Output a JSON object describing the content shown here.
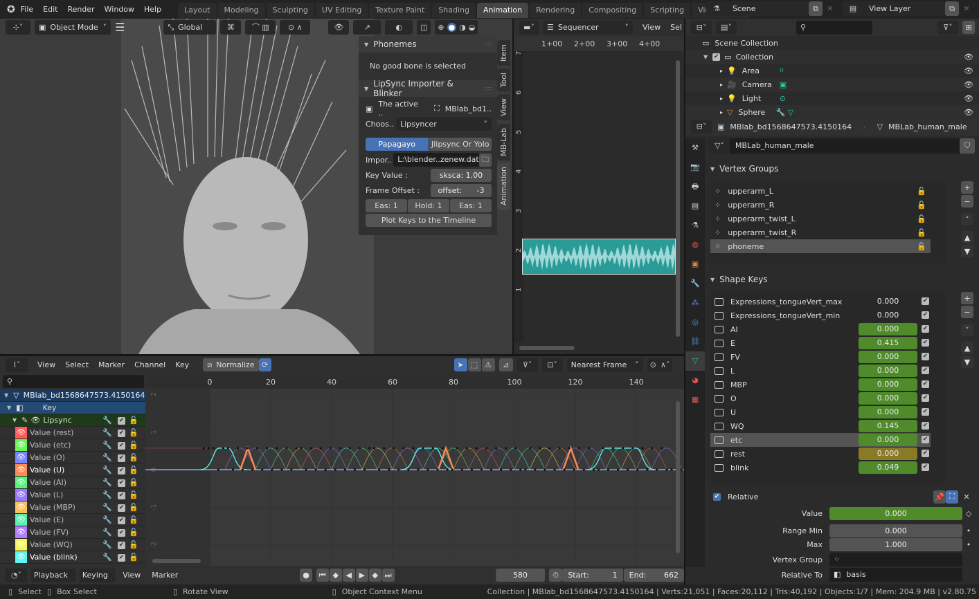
{
  "topbar": {
    "menus": [
      "File",
      "Edit",
      "Render",
      "Window",
      "Help"
    ],
    "workspaces": [
      "Layout",
      "Modeling",
      "Sculpting",
      "UV Editing",
      "Texture Paint",
      "Shading",
      "Animation",
      "Rendering",
      "Compositing",
      "Scripting",
      "Video Editin"
    ],
    "active_workspace": "Animation",
    "scene": "Scene",
    "view_layer": "View Layer"
  },
  "viewport": {
    "mode": "Object Mode",
    "orientation": "Global"
  },
  "npanel": {
    "phonemes_title": "Phonemes",
    "no_bone": "No good bone is selected",
    "lipsync_title": "LipSync Importer & Blinker",
    "active_label": "The active ..",
    "active_obj": "MBlab_bd1..",
    "choose_label": "Choos..",
    "choose_value": "Lipsyncer",
    "tab_a": "Papagayo",
    "tab_b": "Jlipsync Or Yolo",
    "import_label": "Impor..",
    "import_path": "L:\\blender..zenew.dat",
    "key_value_label": "Key Value :",
    "key_value": "sksca: 1.00",
    "frame_offset_label": "Frame Offset :",
    "offset_label": "offset:",
    "offset_value": "-3",
    "eas1": "Eas: 1",
    "hold": "Hold: 1",
    "eas2": "Eas: 1",
    "plot": "Plot Keys to the Timeline",
    "tabs": [
      "Item",
      "Tool",
      "View",
      "MB-Lab",
      "Animation"
    ]
  },
  "sequencer": {
    "mode": "Sequencer",
    "menus": [
      "View",
      "Sel"
    ],
    "ruler": [
      "1+00",
      "2+00",
      "3+00",
      "4+00"
    ],
    "channels": [
      "7",
      "6",
      "5",
      "4",
      "3",
      "2",
      "1"
    ],
    "strip_color": "#2a9b97"
  },
  "outliner": {
    "root": "Scene Collection",
    "collection": "Collection",
    "items": [
      "Area",
      "Camera",
      "Light",
      "Sphere"
    ]
  },
  "properties": {
    "object": "MBlab_bd1568647573.4150164",
    "mesh": "MBLab_human_male",
    "mesh_field": "MBLab_human_male",
    "vertex_groups_title": "Vertex Groups",
    "vertex_groups": [
      "upperarm_L",
      "upperarm_R",
      "upperarm_twist_L",
      "upperarm_twist_R",
      "phoneme"
    ],
    "vertex_group_selected": "phoneme",
    "shape_keys_title": "Shape Keys",
    "shape_keys": [
      {
        "name": "Expressions_tongueVert_max",
        "value": "0.000",
        "bar": false
      },
      {
        "name": "Expressions_tongueVert_min",
        "value": "0.000",
        "bar": false
      },
      {
        "name": "AI",
        "value": "0.000",
        "bar": true
      },
      {
        "name": "E",
        "value": "0.415",
        "bar": true
      },
      {
        "name": "FV",
        "value": "0.000",
        "bar": true
      },
      {
        "name": "L",
        "value": "0.000",
        "bar": true
      },
      {
        "name": "MBP",
        "value": "0.000",
        "bar": true
      },
      {
        "name": "O",
        "value": "0.000",
        "bar": true
      },
      {
        "name": "U",
        "value": "0.000",
        "bar": true
      },
      {
        "name": "WQ",
        "value": "0.145",
        "bar": true
      },
      {
        "name": "etc",
        "value": "0.000",
        "bar": true,
        "selected": true
      },
      {
        "name": "rest",
        "value": "0.000",
        "bar": true,
        "muted": true
      },
      {
        "name": "blink",
        "value": "0.049",
        "bar": true
      }
    ],
    "relative_label": "Relative",
    "value_label": "Value",
    "value": "0.000",
    "range_min_label": "Range Min",
    "range_min": "0.000",
    "max_label": "Max",
    "max": "1.000",
    "vertex_group_label": "Vertex Group",
    "relative_to_label": "Relative To",
    "relative_to": "basis",
    "colors": {
      "keyed": "#4f8a2b",
      "muted": "#8a7a26"
    }
  },
  "graph": {
    "menus": [
      "View",
      "Select",
      "Marker",
      "Channel",
      "Key"
    ],
    "normalize": "Normalize",
    "snap": "Nearest Frame",
    "frames": [
      "0",
      "20",
      "40",
      "60",
      "80",
      "100",
      "120",
      "140"
    ],
    "yticks": [
      "2",
      "1",
      "0",
      "-1",
      "-2"
    ],
    "object": "MBlab_bd1568647573.4150164",
    "key": "Key",
    "action": "Lipsync",
    "channels": [
      {
        "name": "Value (rest)",
        "color": "#ff5b5b"
      },
      {
        "name": "Value (etc)",
        "color": "#6cf55b"
      },
      {
        "name": "Value (O)",
        "color": "#7a86ff"
      },
      {
        "name": "Value (U)",
        "color": "#ff8a52",
        "active": true
      },
      {
        "name": "Value (AI)",
        "color": "#5cf07c"
      },
      {
        "name": "Value (L)",
        "color": "#9a7bff"
      },
      {
        "name": "Value (MBP)",
        "color": "#ffbf5c"
      },
      {
        "name": "Value (E)",
        "color": "#5cf0b0"
      },
      {
        "name": "Value (FV)",
        "color": "#b57bff"
      },
      {
        "name": "Value (WQ)",
        "color": "#f5f55b"
      },
      {
        "name": "Value (blink)",
        "color": "#5cf5f5",
        "active": true
      }
    ]
  },
  "timeline": {
    "menus": [
      "Playback",
      "Keying",
      "View",
      "Marker"
    ],
    "current": "580",
    "start_label": "Start:",
    "start": "1",
    "end_label": "End:",
    "end": "662"
  },
  "status": {
    "select": "Select",
    "box": "Box Select",
    "rotate": "Rotate View",
    "context": "Object Context Menu",
    "info": "Collection | MBlab_bd1568647573.4150164 | Verts:21,051 | Faces:20,112 | Tris:40,192 | Objects:1/7 | Mem: 204.9 MB | v2.80.75"
  }
}
